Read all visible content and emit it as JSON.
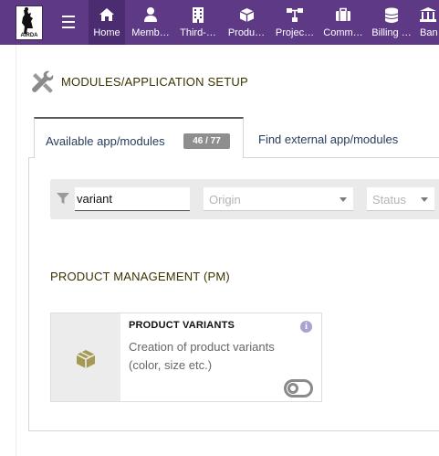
{
  "topbar": {
    "logo_text": "AIRDA",
    "nav": [
      {
        "label": "Home",
        "icon": "home-icon"
      },
      {
        "label": "Memb…",
        "icon": "user-icon"
      },
      {
        "label": "Third-…",
        "icon": "building-icon"
      },
      {
        "label": "Produ…",
        "icon": "cube-icon"
      },
      {
        "label": "Projec…",
        "icon": "sitemap-icon"
      },
      {
        "label": "Comm…",
        "icon": "briefcase-icon"
      },
      {
        "label": "Billing …",
        "icon": "coins-icon"
      },
      {
        "label": "Ban",
        "icon": "bank-icon"
      }
    ],
    "colors": {
      "bar": "#5e3a86",
      "active": "#4b2c70"
    }
  },
  "page": {
    "title": "MODULES/APPLICATION SETUP",
    "title_icon": "tools-icon"
  },
  "tabs": {
    "available_label": "Available app/modules",
    "available_count": "46 / 77",
    "external_label": "Find external app/modules"
  },
  "filters": {
    "search_value": "variant",
    "origin_placeholder": "Origin",
    "status_placeholder": "Status"
  },
  "section": {
    "title": "PRODUCT MANAGEMENT (PM)"
  },
  "module": {
    "title": "PRODUCT VARIANTS",
    "description": "Creation of product variants (color, size etc.)",
    "icon": "box-icon",
    "info_glyph": "i",
    "enabled": false
  }
}
